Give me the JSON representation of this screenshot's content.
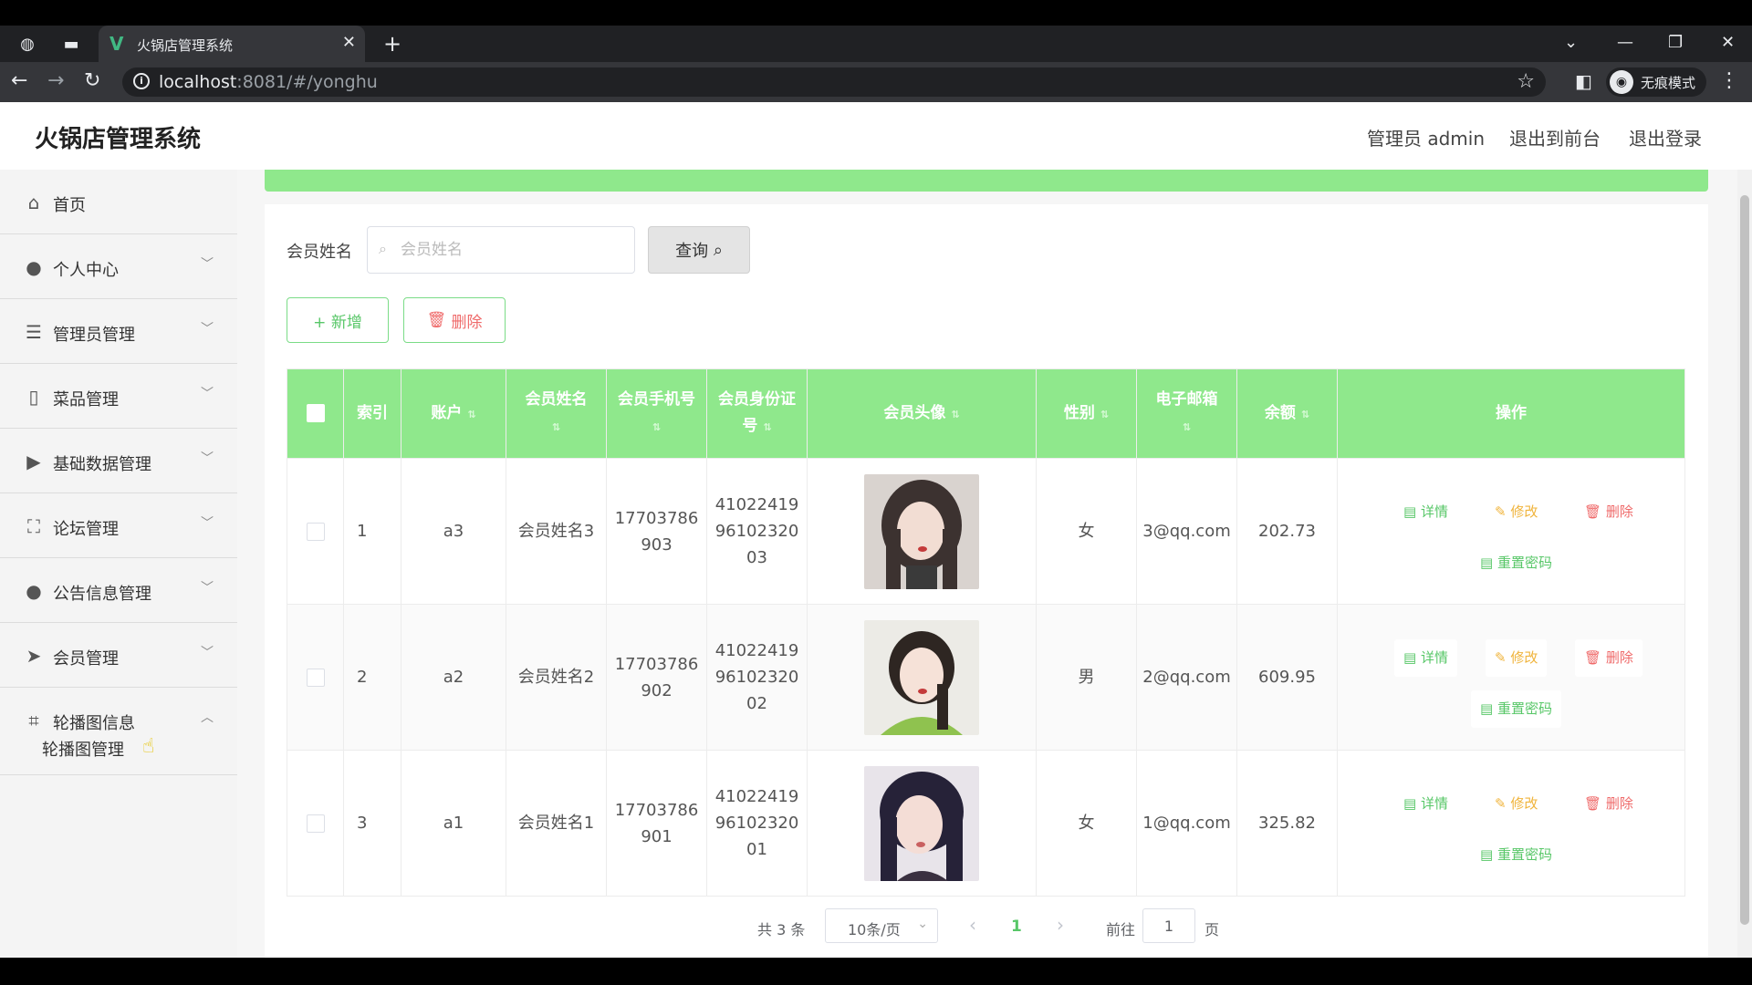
{
  "browser": {
    "tab_title": "火锅店管理系统",
    "url_host": "localhost",
    "url_rest": ":8081/#/yonghu",
    "incognito_label": "无痕模式"
  },
  "header": {
    "brand": "火锅店管理系统",
    "admin": "管理员 admin",
    "back_to_front": "退出到前台",
    "logout": "退出登录"
  },
  "sidebar": {
    "items": [
      {
        "label": "首页",
        "icon": "home-icon"
      },
      {
        "label": "个人中心",
        "icon": "user-icon"
      },
      {
        "label": "管理员管理",
        "icon": "list-icon"
      },
      {
        "label": "菜品管理",
        "icon": "dish-icon"
      },
      {
        "label": "基础数据管理",
        "icon": "data-icon"
      },
      {
        "label": "论坛管理",
        "icon": "forum-icon"
      },
      {
        "label": "公告信息管理",
        "icon": "notice-icon"
      },
      {
        "label": "会员管理",
        "icon": "send-icon"
      },
      {
        "label": "轮播图信息",
        "icon": "crop-icon"
      }
    ],
    "submenu": "轮播图管理"
  },
  "search": {
    "label": "会员姓名",
    "placeholder": "会员姓名",
    "button": "查询"
  },
  "actions": {
    "add": "+ 新增",
    "delete": "删除"
  },
  "table": {
    "headers": [
      "索引",
      "账户",
      "会员姓名",
      "会员手机号",
      "会员身份证号",
      "会员头像",
      "性别",
      "电子邮箱",
      "余额",
      "操作"
    ],
    "rows": [
      {
        "index": "1",
        "account": "a3",
        "name": "会员姓名3",
        "phone": "17703786903",
        "idcard": "410224199610232003",
        "gender": "女",
        "email": "3@qq.com",
        "balance": "202.73"
      },
      {
        "index": "2",
        "account": "a2",
        "name": "会员姓名2",
        "phone": "17703786902",
        "idcard": "410224199610232002",
        "gender": "男",
        "email": "2@qq.com",
        "balance": "609.95"
      },
      {
        "index": "3",
        "account": "a1",
        "name": "会员姓名1",
        "phone": "17703786901",
        "idcard": "410224199610232001",
        "gender": "女",
        "email": "1@qq.com",
        "balance": "325.82"
      }
    ],
    "ops": {
      "detail": "详情",
      "edit": "修改",
      "delete": "删除",
      "reset": "重置密码"
    }
  },
  "pagination": {
    "total": "共 3 条",
    "page_size": "10条/页",
    "current": "1",
    "goto": "前往",
    "goto_value": "1",
    "unit": "页"
  },
  "colors": {
    "accent": "#8fe88c",
    "green_text": "#58c768",
    "red_text": "#ef6a6a",
    "orange_text": "#f0b43c"
  }
}
